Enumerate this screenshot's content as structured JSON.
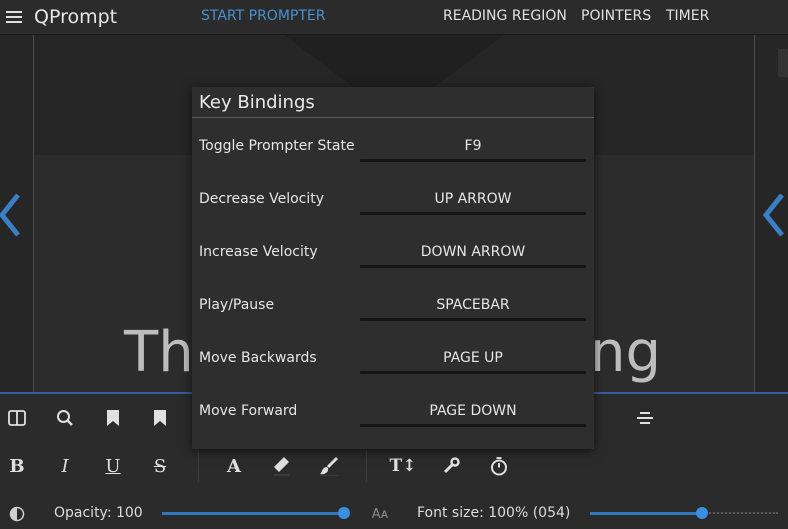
{
  "header": {
    "app_title": "QPrompt",
    "nav": {
      "start_prompter": "START PROMPTER",
      "reading_region": "READING REGION",
      "pointers": "POINTERS",
      "timer": "TIMER"
    }
  },
  "editor": {
    "visible_text_left": "Th",
    "visible_text_right": "ng"
  },
  "key_bindings_dialog": {
    "title": "Key Bindings",
    "bindings": [
      {
        "action": "Toggle Prompter State",
        "key": "F9"
      },
      {
        "action": "Decrease Velocity",
        "key": "UP ARROW"
      },
      {
        "action": "Increase Velocity",
        "key": "DOWN ARROW"
      },
      {
        "action": "Play/Pause",
        "key": "SPACEBAR"
      },
      {
        "action": "Move Backwards",
        "key": "PAGE UP"
      },
      {
        "action": "Move Forward",
        "key": "PAGE DOWN"
      }
    ]
  },
  "toolbar": {
    "opacity_label": "Opacity: 100",
    "opacity_value": 100,
    "font_size_label": "Font size: 100% (054)",
    "font_size_fraction": 0.59,
    "opacity_fraction": 1.0
  },
  "colors": {
    "accent": "#4a90d0",
    "slider": "#2f78c0",
    "toolbar_border": "#3d5a9e"
  },
  "icons": {
    "row1": [
      "columns-icon",
      "search-icon",
      "bookmark-icon",
      "bookmark-icon",
      "align-center-icon"
    ],
    "row2": [
      "bold-icon",
      "italic-icon",
      "underline-icon",
      "strikethrough-icon",
      "font-icon",
      "highlighter-icon",
      "brush-icon",
      "text-height-icon",
      "wrench-icon",
      "stopwatch-icon"
    ],
    "row3": [
      "contrast-icon",
      "font-size-icon"
    ]
  }
}
